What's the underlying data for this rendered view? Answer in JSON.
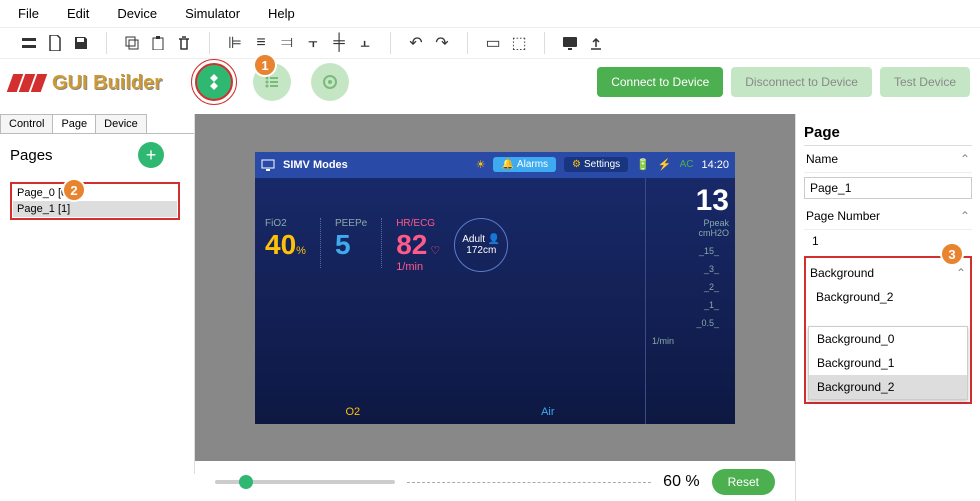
{
  "menu": {
    "file": "File",
    "edit": "Edit",
    "device": "Device",
    "simulator": "Simulator",
    "help": "Help"
  },
  "logo": "GUI Builder",
  "connect": {
    "connect": "Connect to Device",
    "disconnect": "Disconnect to Device",
    "test": "Test Device"
  },
  "tabs": {
    "control": "Control",
    "page": "Page",
    "device": "Device"
  },
  "pages": {
    "header": "Pages",
    "items": [
      "Page_0 [0]",
      "Page_1 [1]"
    ]
  },
  "callouts": {
    "c1": "1",
    "c2": "2",
    "c3": "3"
  },
  "screen": {
    "title": "SIMV Modes",
    "alarms": "Alarms",
    "settings": "Settings",
    "ac": "AC",
    "time": "14:20",
    "ppeak_val": "13",
    "ppeak_lbl1": "Ppeak",
    "ppeak_lbl2": "cmH2O",
    "fio2_lbl": "FiO2",
    "fio2_val": "40",
    "fio2_unit": "%",
    "peepe_lbl": "PEEPe",
    "peepe_val": "5",
    "hr_lbl": "HR/ECG",
    "hr_val": "82",
    "hr_unit": "1/min",
    "adult_lbl": "Adult",
    "adult_val": "172cm",
    "scale": [
      "_15_",
      "_3_",
      "_2_",
      "_1_",
      "_0.5_"
    ],
    "unit": "1/min",
    "o2": "O2",
    "air": "Air"
  },
  "props": {
    "title": "Page",
    "name_lbl": "Name",
    "name_val": "Page_1",
    "num_lbl": "Page Number",
    "num_val": "1",
    "bg_lbl": "Background",
    "bg_val": "Background_2",
    "bg_opts": [
      "Background_0",
      "Background_1",
      "Background_2"
    ]
  },
  "slider": {
    "pct": "60 %",
    "reset": "Reset"
  }
}
